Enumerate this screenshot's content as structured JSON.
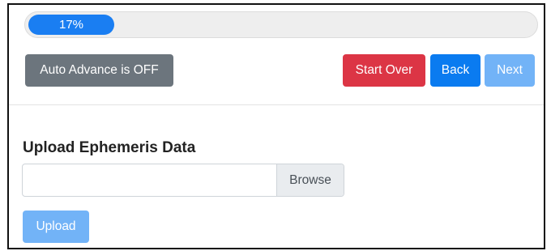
{
  "progress": {
    "label": "17%",
    "value": 0.17,
    "fill_color": "#1a7ef2"
  },
  "toolbar": {
    "auto_advance_label": "Auto Advance is OFF",
    "start_over_label": "Start Over",
    "back_label": "Back",
    "next_label": "Next"
  },
  "upload": {
    "title": "Upload Ephemeris Data",
    "file_value": "",
    "browse_label": "Browse",
    "upload_label": "Upload"
  },
  "colors": {
    "primary": "#0a7bf0",
    "primary_disabled": "#72b3f7",
    "danger": "#dc3545",
    "secondary": "#6c757d"
  }
}
